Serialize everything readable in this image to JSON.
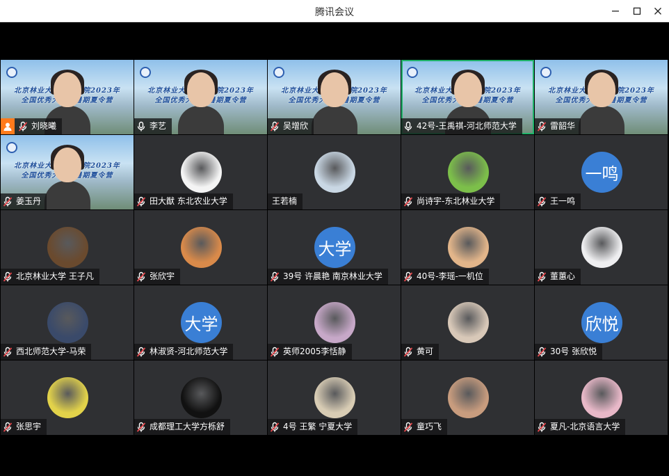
{
  "window": {
    "title": "腾讯会议"
  },
  "participants": [
    {
      "name": "刘晓曦",
      "kind": "video",
      "host": true,
      "muted": true,
      "banner": [
        "北京林业大学外语学院2023年",
        "全国优秀大学生暑期夏令营"
      ]
    },
    {
      "name": "李艺",
      "kind": "video",
      "muted": false,
      "banner": [
        "北京林业大学外语学院2023年",
        "全国优秀大学生暑期夏令营"
      ]
    },
    {
      "name": "吴增欣",
      "kind": "video",
      "muted": true,
      "banner": [
        "北京林业大学外语学院2023年",
        "全国优秀大学生暑期夏令营"
      ]
    },
    {
      "name": "42号-王禹祺-河北师范大学",
      "kind": "video",
      "muted": false,
      "speaking": true,
      "banner": [
        "北京林业大学外语学院2023年",
        "全国优秀大学生暑期夏令营"
      ]
    },
    {
      "name": "雷韶华",
      "kind": "video",
      "muted": true,
      "banner": [
        "北京林业大学外语学院2023年",
        "全国优秀大学生暑期夏令营"
      ]
    },
    {
      "name": "姜玉丹",
      "kind": "video",
      "muted": true,
      "banner": [
        "北京林业大学外语学院2023年",
        "全国优秀大学生暑期夏令营"
      ]
    },
    {
      "name": "田大猷 东北农业大学",
      "kind": "avatar",
      "avatar": "cartoon-man-icon",
      "color": "#f4f4f4",
      "muted": true
    },
    {
      "name": "王若楠",
      "kind": "avatar",
      "avatar": "girl-photo-icon",
      "color": "#c9d7e4",
      "muted": false,
      "nomic": true
    },
    {
      "name": "尚诗宇-东北林业大学",
      "kind": "avatar",
      "avatar": "green-field-icon",
      "color": "#7cbf4a",
      "muted": true
    },
    {
      "name": "王一鸣",
      "kind": "avatar",
      "avatar_text": "一鸣",
      "muted": true
    },
    {
      "name": "北京林业大学 王子凡",
      "kind": "avatar",
      "avatar": "teddy-bear-icon",
      "color": "#6a4a2e",
      "muted": true
    },
    {
      "name": "张欣宇",
      "kind": "avatar",
      "avatar": "anime-girl-icon",
      "color": "#d98a4a",
      "muted": true
    },
    {
      "name": "39号 许晨艳 南京林业大学",
      "kind": "avatar",
      "avatar_text": "大学",
      "muted": true
    },
    {
      "name": "40号-李瑶-一机位",
      "kind": "avatar",
      "avatar": "pixel-dog-icon",
      "color": "#e2b58a",
      "muted": true
    },
    {
      "name": "董蕙心",
      "kind": "avatar",
      "avatar": "girl-white-dress-icon",
      "color": "#eeeef0",
      "muted": true
    },
    {
      "name": "西北师范大学-马荣",
      "kind": "avatar",
      "avatar": "celebration-icon",
      "color": "#3a4a6a",
      "muted": true
    },
    {
      "name": "林淑贤-河北师范大学",
      "kind": "avatar",
      "avatar_text": "大学",
      "muted": true
    },
    {
      "name": "英师2005李恬静",
      "kind": "avatar",
      "avatar": "child-costume-icon",
      "color": "#c7a8c8",
      "muted": true
    },
    {
      "name": "黄可",
      "kind": "avatar",
      "avatar": "girl-selfie-icon",
      "color": "#d8c8b8",
      "muted": true
    },
    {
      "name": "30号 张欣悦",
      "kind": "avatar",
      "avatar_text": "欣悦",
      "muted": true
    },
    {
      "name": "张思宇",
      "kind": "avatar",
      "avatar": "colorful-art-icon",
      "color": "#e2d24a",
      "muted": true
    },
    {
      "name": "成都理工大学方栎舒",
      "kind": "avatar",
      "avatar": "spider-mask-icon",
      "color": "#111111",
      "muted": true
    },
    {
      "name": "4号 王繁 宁夏大学",
      "kind": "avatar",
      "avatar": "sleeping-cat-icon",
      "color": "#d8ccb4",
      "muted": true
    },
    {
      "name": "童巧飞",
      "kind": "avatar",
      "avatar": "child-photo-icon",
      "color": "#c89c7e",
      "muted": true
    },
    {
      "name": "夏凡-北京语言大学",
      "kind": "avatar",
      "avatar": "cherry-blossom-icon",
      "color": "#e8b8c8",
      "muted": true
    }
  ]
}
